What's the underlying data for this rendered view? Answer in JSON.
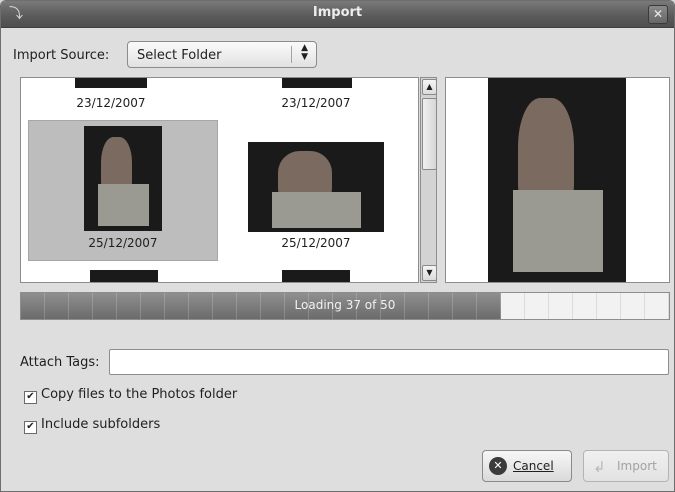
{
  "window": {
    "title": "Import"
  },
  "import_source": {
    "label": "Import Source:",
    "selected": "Select Folder"
  },
  "thumbnails": [
    {
      "date": "23/12/2007"
    },
    {
      "date": "23/12/2007"
    },
    {
      "date": "25/12/2007"
    },
    {
      "date": "25/12/2007"
    }
  ],
  "progress": {
    "text": "Loading 37 of 50",
    "current": 37,
    "total": 50
  },
  "tags": {
    "label": "Attach Tags:",
    "value": ""
  },
  "options": {
    "copy_files": {
      "label": "Copy files to the Photos folder",
      "checked": true
    },
    "include_subfolders": {
      "label": "Include subfolders",
      "checked": true
    }
  },
  "buttons": {
    "cancel": {
      "label": "Cancel",
      "icon": "cancel-icon"
    },
    "import": {
      "label": "Import",
      "icon": "import-icon",
      "enabled": false
    }
  }
}
